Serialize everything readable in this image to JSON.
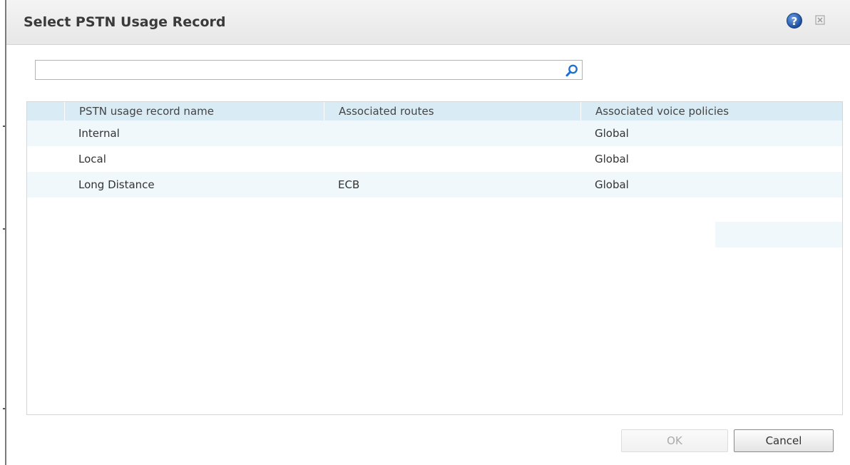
{
  "dialog": {
    "title": "Select PSTN Usage Record",
    "help_icon": "help-icon",
    "help_glyph": "?",
    "close_icon": "close-icon"
  },
  "search": {
    "value": "",
    "placeholder": "",
    "icon": "search-icon"
  },
  "table": {
    "columns": [
      "PSTN usage record name",
      "Associated routes",
      "Associated voice policies"
    ],
    "rows": [
      [
        "Internal",
        "",
        "Global"
      ],
      [
        "Local",
        "",
        "Global"
      ],
      [
        "Long Distance",
        "ECB",
        "Global"
      ]
    ]
  },
  "buttons": {
    "ok_label": "OK",
    "ok_enabled": false,
    "cancel_label": "Cancel"
  },
  "colors": {
    "header_bg": "#d9ecf6",
    "alt_row_bg": "#f0f8fc",
    "help_blue": "#1b4f9e"
  }
}
